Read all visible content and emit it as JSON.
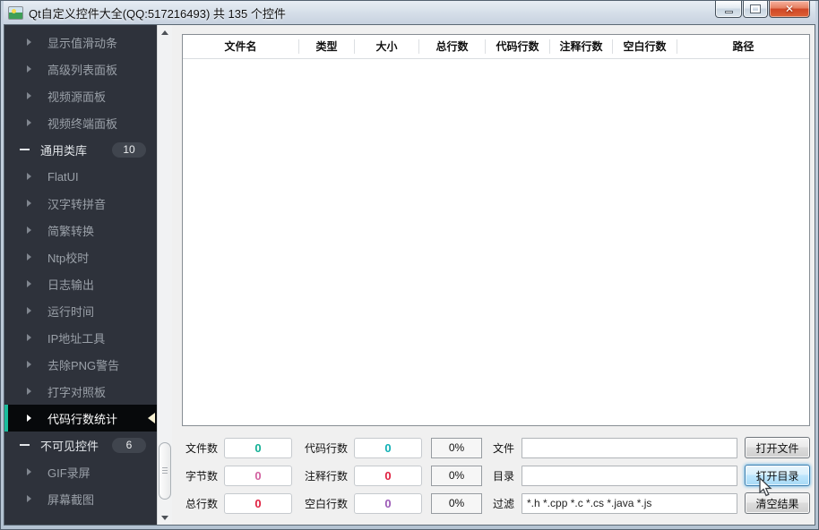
{
  "window": {
    "title": "Qt自定义控件大全(QQ:517216493) 共 135 个控件"
  },
  "colors": {
    "accent": "#1abc9c",
    "sidebar_bg": "#2e323b",
    "selected_bg": "#07090b"
  },
  "sidebar": {
    "items": [
      {
        "label": "显示值滑动条",
        "type": "item"
      },
      {
        "label": "高级列表面板",
        "type": "item"
      },
      {
        "label": "视频源面板",
        "type": "item"
      },
      {
        "label": "视频终端面板",
        "type": "item"
      },
      {
        "label": "通用类库",
        "type": "group",
        "badge": "10"
      },
      {
        "label": "FlatUI",
        "type": "item"
      },
      {
        "label": "汉字转拼音",
        "type": "item"
      },
      {
        "label": "简繁转换",
        "type": "item"
      },
      {
        "label": "Ntp校时",
        "type": "item"
      },
      {
        "label": "日志输出",
        "type": "item"
      },
      {
        "label": "运行时间",
        "type": "item"
      },
      {
        "label": "IP地址工具",
        "type": "item"
      },
      {
        "label": "去除PNG警告",
        "type": "item"
      },
      {
        "label": "打字对照板",
        "type": "item"
      },
      {
        "label": "代码行数统计",
        "type": "item",
        "selected": true
      },
      {
        "label": "不可见控件",
        "type": "group",
        "badge": "6"
      },
      {
        "label": "GIF录屏",
        "type": "item"
      },
      {
        "label": "屏幕截图",
        "type": "item"
      }
    ]
  },
  "table": {
    "headers": [
      "文件名",
      "类型",
      "大小",
      "总行数",
      "代码行数",
      "注释行数",
      "空白行数",
      "路径"
    ],
    "rows": []
  },
  "form": {
    "rows": [
      {
        "stat1": {
          "label": "文件数",
          "value": "0",
          "color": "#12b095"
        },
        "stat2": {
          "label": "代码行数",
          "value": "0",
          "color": "#0fb0b5"
        },
        "percent": "0%",
        "field": {
          "label": "文件",
          "value": "",
          "name": "file"
        },
        "button": {
          "label": "打开文件",
          "name": "open-file",
          "state": "normal"
        }
      },
      {
        "stat1": {
          "label": "字节数",
          "value": "0",
          "color": "#d2609f"
        },
        "stat2": {
          "label": "注释行数",
          "value": "0",
          "color": "#e02040"
        },
        "percent": "0%",
        "field": {
          "label": "目录",
          "value": "",
          "name": "dir"
        },
        "button": {
          "label": "打开目录",
          "name": "open-dir",
          "state": "hover"
        }
      },
      {
        "stat1": {
          "label": "总行数",
          "value": "0",
          "color": "#e02040"
        },
        "stat2": {
          "label": "空白行数",
          "value": "0",
          "color": "#9b59b6"
        },
        "percent": "0%",
        "field": {
          "label": "过滤",
          "value": "*.h *.cpp *.c *.cs *.java *.js",
          "name": "filter"
        },
        "button": {
          "label": "清空结果",
          "name": "clear-results",
          "state": "normal"
        }
      }
    ]
  }
}
